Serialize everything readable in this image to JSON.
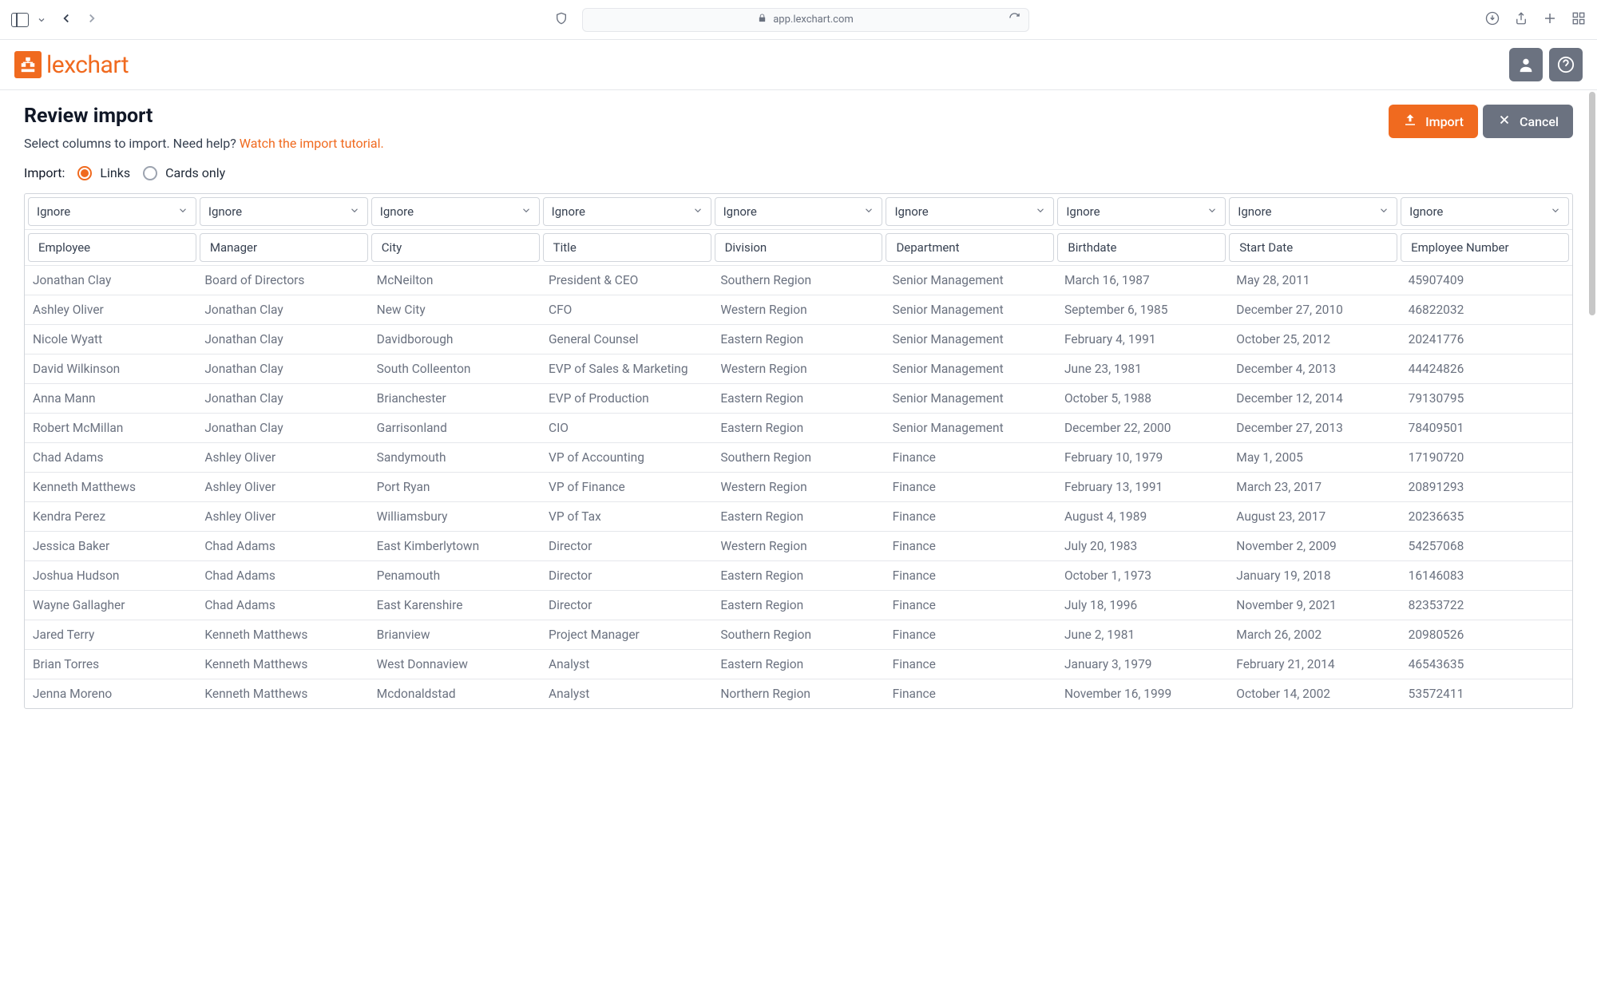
{
  "browser": {
    "url_host": "app.lexchart.com"
  },
  "app": {
    "logo_text": "lexchart"
  },
  "page": {
    "title": "Review import",
    "help_prefix": "Select columns to import. Need help? ",
    "help_link_text": "Watch the import tutorial.",
    "import_btn": "Import",
    "cancel_btn": "Cancel",
    "import_mode_label": "Import:",
    "radio_links": "Links",
    "radio_cards_only": "Cards only",
    "selected_radio": "links"
  },
  "column_selector_value": "Ignore",
  "columns": [
    "Employee",
    "Manager",
    "City",
    "Title",
    "Division",
    "Department",
    "Birthdate",
    "Start Date",
    "Employee Number"
  ],
  "rows": [
    [
      "Jonathan Clay",
      "Board of Directors",
      "McNeilton",
      "President & CEO",
      "Southern Region",
      "Senior Management",
      "March 16, 1987",
      "May 28, 2011",
      "45907409"
    ],
    [
      "Ashley Oliver",
      "Jonathan Clay",
      "New City",
      "CFO",
      "Western Region",
      "Senior Management",
      "September 6, 1985",
      "December 27, 2010",
      "46822032"
    ],
    [
      "Nicole Wyatt",
      "Jonathan Clay",
      "Davidborough",
      "General Counsel",
      "Eastern Region",
      "Senior Management",
      "February 4, 1991",
      "October 25, 2012",
      "20241776"
    ],
    [
      "David Wilkinson",
      "Jonathan Clay",
      "South Colleenton",
      "EVP of Sales & Marketing",
      "Western Region",
      "Senior Management",
      "June 23, 1981",
      "December 4, 2013",
      "44424826"
    ],
    [
      "Anna Mann",
      "Jonathan Clay",
      "Brianchester",
      "EVP of Production",
      "Eastern Region",
      "Senior Management",
      "October 5, 1988",
      "December 12, 2014",
      "79130795"
    ],
    [
      "Robert McMillan",
      "Jonathan Clay",
      "Garrisonland",
      "CIO",
      "Eastern Region",
      "Senior Management",
      "December 22, 2000",
      "December 27, 2013",
      "78409501"
    ],
    [
      "Chad Adams",
      "Ashley Oliver",
      "Sandymouth",
      "VP of Accounting",
      "Southern Region",
      "Finance",
      "February 10, 1979",
      "May 1, 2005",
      "17190720"
    ],
    [
      "Kenneth Matthews",
      "Ashley Oliver",
      "Port Ryan",
      "VP of Finance",
      "Western Region",
      "Finance",
      "February 13, 1991",
      "March 23, 2017",
      "20891293"
    ],
    [
      "Kendra Perez",
      "Ashley Oliver",
      "Williamsbury",
      "VP of Tax",
      "Eastern Region",
      "Finance",
      "August 4, 1989",
      "August 23, 2017",
      "20236635"
    ],
    [
      "Jessica Baker",
      "Chad Adams",
      "East Kimberlytown",
      "Director",
      "Western Region",
      "Finance",
      "July 20, 1983",
      "November 2, 2009",
      "54257068"
    ],
    [
      "Joshua Hudson",
      "Chad Adams",
      "Penamouth",
      "Director",
      "Eastern Region",
      "Finance",
      "October 1, 1973",
      "January 19, 2018",
      "16146083"
    ],
    [
      "Wayne Gallagher",
      "Chad Adams",
      "East Karenshire",
      "Director",
      "Eastern Region",
      "Finance",
      "July 18, 1996",
      "November 9, 2021",
      "82353722"
    ],
    [
      "Jared Terry",
      "Kenneth Matthews",
      "Brianview",
      "Project Manager",
      "Southern Region",
      "Finance",
      "June 2, 1981",
      "March 26, 2002",
      "20980526"
    ],
    [
      "Brian Torres",
      "Kenneth Matthews",
      "West Donnaview",
      "Analyst",
      "Eastern Region",
      "Finance",
      "January 3, 1979",
      "February 21, 2014",
      "46543635"
    ],
    [
      "Jenna Moreno",
      "Kenneth Matthews",
      "Mcdonaldstad",
      "Analyst",
      "Northern Region",
      "Finance",
      "November 16, 1999",
      "October 14, 2002",
      "53572411"
    ]
  ]
}
